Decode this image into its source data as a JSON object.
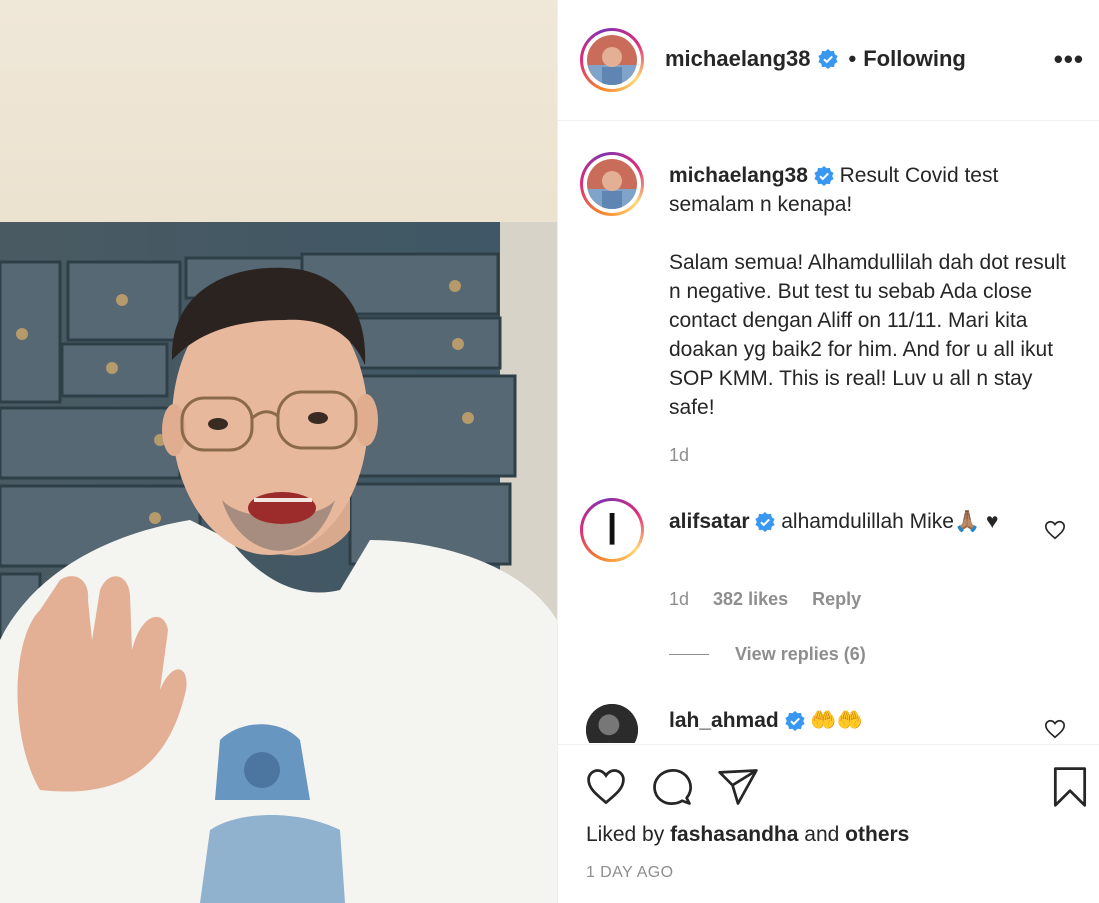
{
  "post": {
    "author": "michaelang38",
    "separator": "•",
    "follow_status": "Following",
    "more_label": "•••"
  },
  "caption": {
    "username": "michaelang38",
    "text_first": " Result Covid test semalam n kenapa!",
    "text_body": "Salam semua! Alhamdullilah dah dot result n negative. But test tu sebab Ada close contact dengan Aliff on 11/11. Mari kita doakan yg baik2 for him. And for u all ikut SOP KMM. This is real! Luv u all n stay safe!",
    "time": "1d"
  },
  "comments": [
    {
      "username": "alifsatar",
      "text": " alhamdulillah Mike🙏🏽 ♥",
      "time": "1d",
      "likes": "382 likes",
      "reply_label": "Reply",
      "avatar_glyph": "ا",
      "view_replies": "View replies (6)"
    },
    {
      "username": "lah_ahmad",
      "text": " 🤲🤲"
    }
  ],
  "footer": {
    "liked_prefix": "Liked by ",
    "liked_user": "fashasandha",
    "liked_mid": " and ",
    "liked_others": "others",
    "date": "1 DAY AGO"
  },
  "icons": {
    "verified": "verified-badge-icon",
    "like": "heart-icon",
    "comment": "comment-bubble-icon",
    "share": "paper-plane-icon",
    "save": "bookmark-icon"
  },
  "colors": {
    "verified_blue": "#3897f0",
    "text_primary": "#262626",
    "text_secondary": "#8e8e8e",
    "border": "#efefef"
  }
}
